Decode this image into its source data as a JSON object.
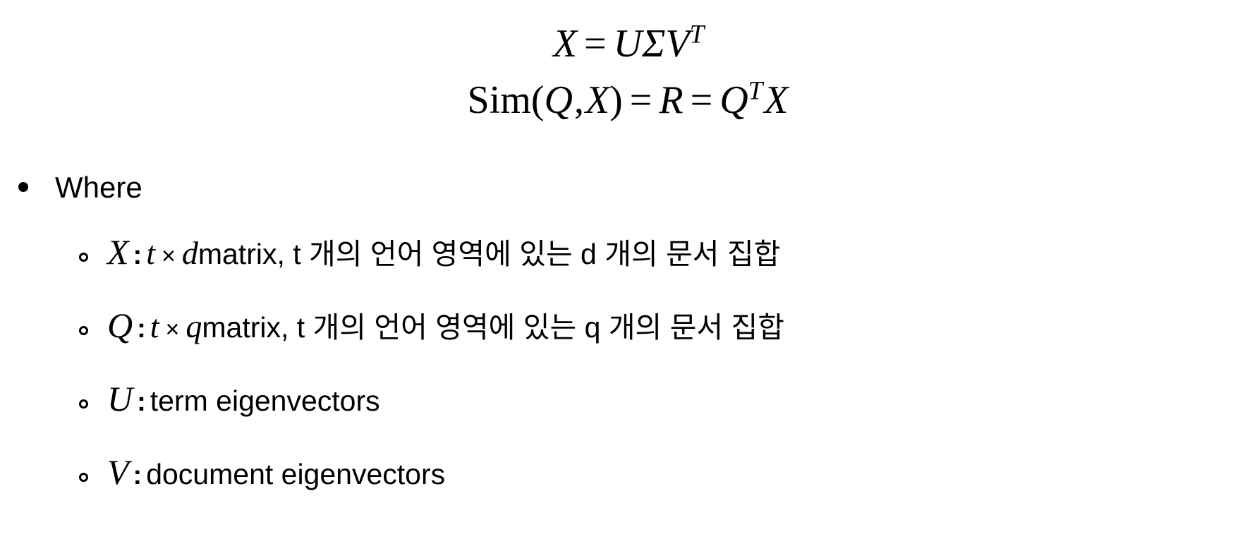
{
  "slide": {
    "background_color": "#ffffff",
    "text_color": "#000000"
  },
  "equations": [
    {
      "id": "svd-decomposition",
      "plain": "X = UΣV^T",
      "parts": {
        "lhs": "X",
        "equals": "=",
        "u": "U",
        "sigma": "Σ",
        "v": "V",
        "transpose": "T"
      }
    },
    {
      "id": "similarity-equation",
      "plain": "Sim(Q, X) = R = Q^T X",
      "parts": {
        "fn": "Sim",
        "open_paren": "(",
        "arg1": "Q",
        "comma": ",",
        "arg2": "X",
        "close_paren": ")",
        "equals1": "=",
        "r": "R",
        "equals2": "=",
        "q": "Q",
        "transpose": "T",
        "x": "X"
      }
    }
  ],
  "bullets": {
    "level1": {
      "marker": "filled-disc",
      "label": "Where"
    },
    "level2_marker": "hollow-circle",
    "items": [
      {
        "id": "definition-X",
        "var": "X",
        "colon": ":",
        "dim_rows": "t",
        "times": "×",
        "dim_cols": "d",
        "description": "matrix, t 개의 언어 영역에 있는 d 개의 문서 집합"
      },
      {
        "id": "definition-Q",
        "var": "Q",
        "colon": ":",
        "dim_rows": "t",
        "times": "×",
        "dim_cols": "q",
        "description": "matrix, t 개의 언어 영역에 있는 q 개의 문서 집합"
      },
      {
        "id": "definition-U",
        "var": "U",
        "colon": ":",
        "dim_rows": "",
        "times": "",
        "dim_cols": "",
        "description": "term eigenvectors"
      },
      {
        "id": "definition-V",
        "var": "V",
        "colon": ":",
        "dim_rows": "",
        "times": "",
        "dim_cols": "",
        "description": "document eigenvectors"
      }
    ]
  }
}
